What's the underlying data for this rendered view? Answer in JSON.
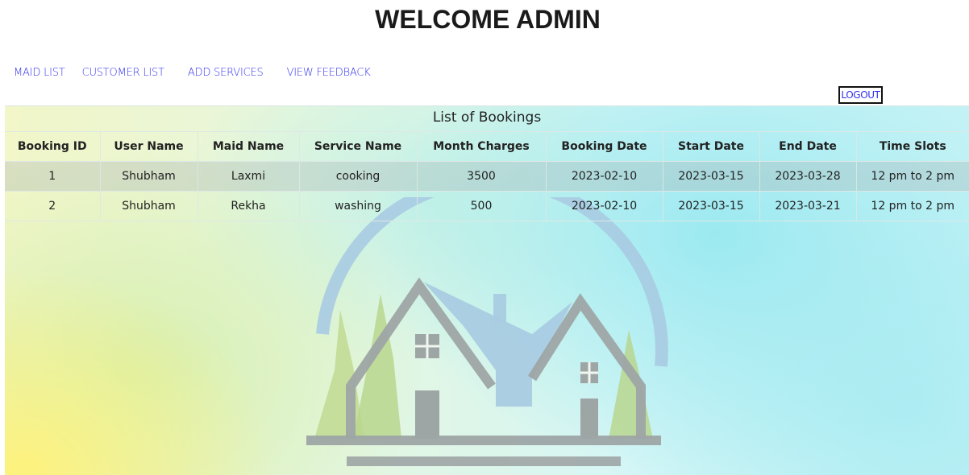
{
  "header": {
    "title": "WELCOME ADMIN"
  },
  "nav": {
    "items": [
      {
        "label": "MAID LIST"
      },
      {
        "label": "CUSTOMER LIST"
      },
      {
        "label": "ADD SERVICES"
      },
      {
        "label": "VIEW FEEDBACK"
      }
    ],
    "logout_label": "LOGOUT"
  },
  "bookings": {
    "caption": "List of Bookings",
    "columns": [
      "Booking ID",
      "User Name",
      "Maid Name",
      "Service Name",
      "Month Charges",
      "Booking Date",
      "Start Date",
      "End Date",
      "Time Slots"
    ],
    "rows": [
      [
        "1",
        "Shubham",
        "Laxmi",
        "cooking",
        "3500",
        "2023-02-10",
        "2023-03-15",
        "2023-03-28",
        "12 pm to 2 pm"
      ],
      [
        "2",
        "Shubham",
        "Rekha",
        "washing",
        "500",
        "2023-02-10",
        "2023-03-15",
        "2023-03-21",
        "12 pm to 2 pm"
      ]
    ]
  },
  "colors": {
    "link": "#3333ee",
    "logo_blue": "#a9cbe2",
    "logo_gray": "#9ea5a5",
    "logo_green": "#b9d68e"
  },
  "icons": {
    "background_logo": "house-logo-icon"
  }
}
